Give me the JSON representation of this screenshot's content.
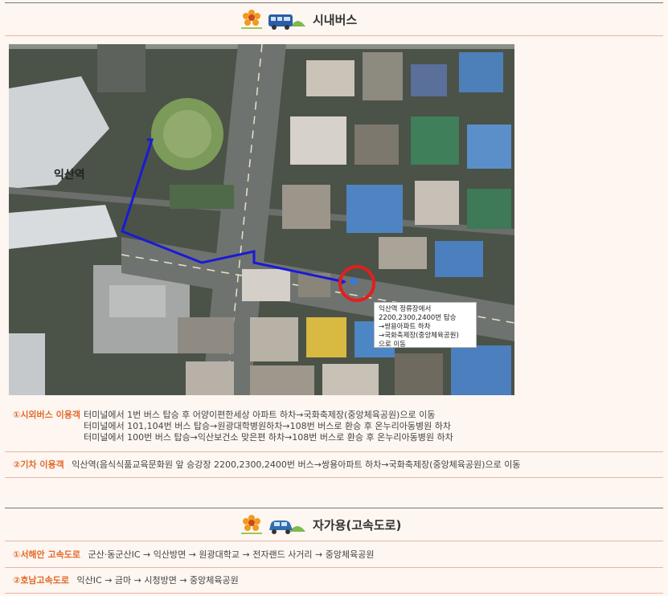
{
  "sections": {
    "bus": {
      "title": "시내버스"
    },
    "car": {
      "title": "자가용(고속도로)"
    }
  },
  "map": {
    "station_label": "익산역",
    "callout": [
      "익산역 정류장에서",
      "2200,2300,2400번 탑승",
      "→쌍용아파트 하차",
      "→국화축제장(중앙체육공원)",
      "으로 이동"
    ],
    "route_color": "#1a1ad6",
    "marker_color": "#e0201f"
  },
  "bus_info": {
    "intercity": {
      "label": "①시외버스 이용객",
      "lines": [
        "터미널에서 1번 버스 탑승 후 어양이편한세상 아파트 하차→국화축제장(중앙체육공원)으로 이동",
        "터미널에서 101,104번 버스 탑승→원광대학병원하차→108번 버스로 환승 후 온누리아동병원 하차",
        "터미널에서 100번 버스 탑승→익산보건소 맞은편 하차→108번 버스로 환승 후 온누리아동병원 하차"
      ]
    },
    "train": {
      "label": "②기차 이용객",
      "text": "익산역(음식식품교육문화원 앞 승강장 2200,2300,2400번 버스→쌍용아파트 하차→국화축제장(중앙체육공원)으로 이동"
    }
  },
  "car_info": {
    "west": {
      "label": "①서해안 고속도로",
      "text": "군산·동군산IC → 익산방면 → 원광대학교 → 전자랜드 사거리 → 중앙체육공원"
    },
    "honam": {
      "label": "②호남고속도로",
      "text": "익산IC → 금마 → 시청방면 → 중앙체육공원"
    }
  },
  "colors": {
    "accent": "#e26a2b",
    "divider": "#e7b7a6"
  }
}
